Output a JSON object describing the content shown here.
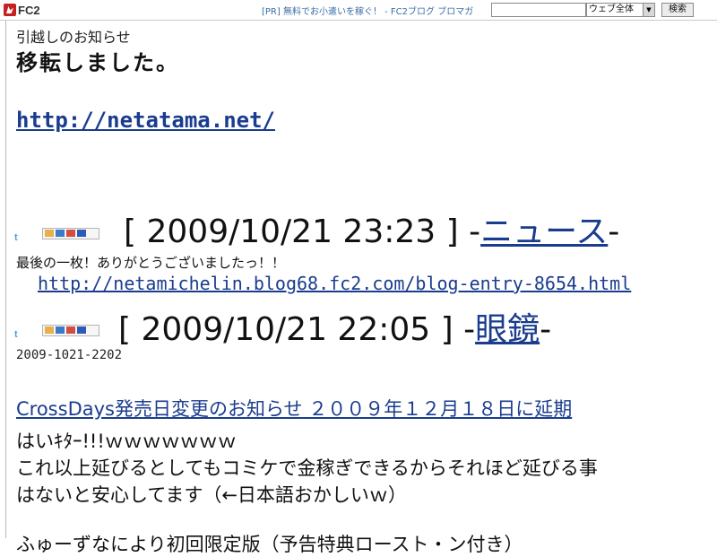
{
  "topbar": {
    "logo_text": "FC2",
    "pr_text": "[PR] 無料でお小遣いを稼ぐ！ - FC2ブログ ブロマガ",
    "search_value": "",
    "search_scope": "ウェブ全体",
    "search_button": "検索"
  },
  "notice": {
    "label": "引越しのお知らせ",
    "heading": "移転しました。",
    "new_url": "http://netatama.net/"
  },
  "entry1": {
    "date": "[ 2009/10/21 23:23 ] -",
    "category": "ニュース",
    "category_suffix": "-",
    "body": "最後の一枚！ありがとうございましたっ！！",
    "link": "http://netamichelin.blog68.fc2.com/blog-entry-8654.html"
  },
  "entry2": {
    "date": "[ 2009/10/21 22:05 ] -",
    "category": "眼鏡",
    "category_suffix": "-",
    "meta": "2009-1021-2202",
    "link": "CrossDays発売日変更のお知らせ ２００９年１２月１８日に延期",
    "text1": "はいｷﾀｰ!!!ｗｗｗｗｗｗｗ",
    "text2": "これ以上延びるとしてもコミケで金稼ぎできるからそれほど延びる事",
    "text3": "はないと安心してます（←日本語おかしいｗ）",
    "text4": "ふゅーずなにより初回限定版（予告特典ロースト・ン付き）"
  },
  "icons": {
    "twitter": "t",
    "bookmark": "bookmark-badges-icon"
  }
}
